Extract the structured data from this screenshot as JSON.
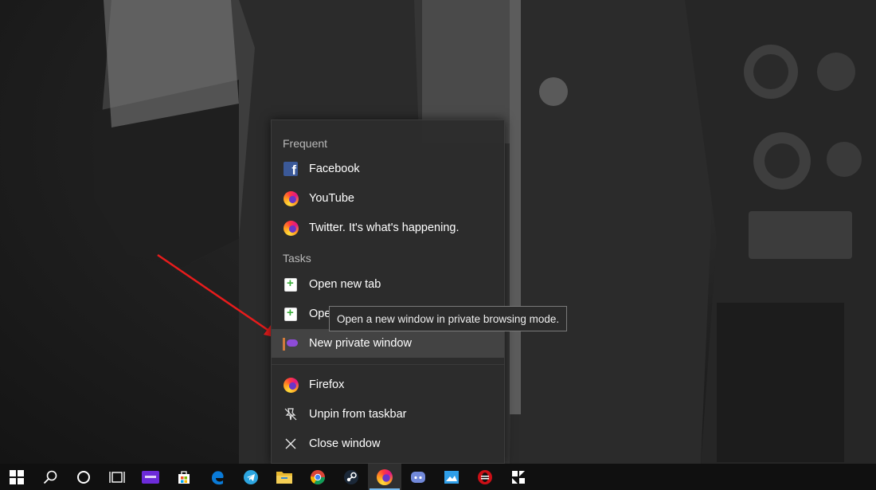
{
  "jumplist": {
    "frequent_title": "Frequent",
    "frequent": [
      {
        "label": "Facebook",
        "icon": "facebook-icon"
      },
      {
        "label": "YouTube",
        "icon": "firefox-icon"
      },
      {
        "label": "Twitter. It's what's happening.",
        "icon": "firefox-icon"
      }
    ],
    "tasks_title": "Tasks",
    "tasks": [
      {
        "label": "Open new tab",
        "icon": "new-tab-icon"
      },
      {
        "label": "Open new window",
        "icon": "new-window-icon"
      },
      {
        "label": "New private window",
        "icon": "private-window-icon"
      }
    ],
    "app": [
      {
        "label": "Firefox",
        "icon": "firefox-icon"
      },
      {
        "label": "Unpin from taskbar",
        "icon": "unpin-icon"
      },
      {
        "label": "Close window",
        "icon": "close-icon"
      }
    ]
  },
  "tooltip": {
    "text": "Open a new window in private browsing mode."
  },
  "taskbar": {
    "items": [
      "start-icon",
      "search-icon",
      "cortana-icon",
      "task-view-icon",
      "twitch-icon",
      "store-icon",
      "edge-icon",
      "telegram-icon",
      "file-explorer-icon",
      "chrome-icon",
      "steam-icon",
      "firefox-icon",
      "discord-icon",
      "photos-icon",
      "opera-icon",
      "app-icon"
    ],
    "active": "firefox-icon"
  },
  "colors": {
    "taskbar": "#101010",
    "jumplist_bg": "#2c2c2c",
    "accent": "#76b9ed",
    "arrow": "#e81c1c"
  }
}
